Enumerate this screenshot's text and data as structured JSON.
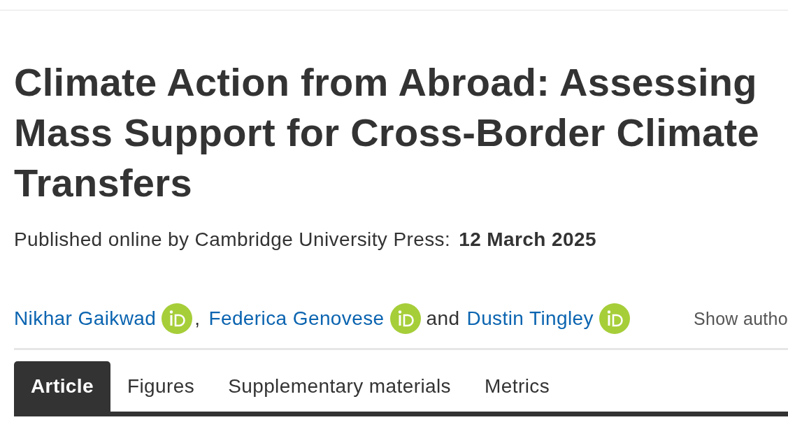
{
  "article": {
    "title": "Climate Action from Abroad: Assessing Mass Support for Cross-Border Climate Transfers",
    "published": {
      "label": "Published online by Cambridge University Press:",
      "date": "12 March 2025"
    },
    "authors": [
      {
        "name": "Nikhar Gaikwad",
        "orcid": true,
        "separator": ","
      },
      {
        "name": "Federica Genovese",
        "orcid": true,
        "separator": "and"
      },
      {
        "name": "Dustin Tingley",
        "orcid": true
      }
    ],
    "show_authors": "Show autho",
    "tabs": [
      {
        "label": "Article",
        "selected": true
      },
      {
        "label": "Figures",
        "selected": false
      },
      {
        "label": "Supplementary materials",
        "selected": false
      },
      {
        "label": "Metrics",
        "selected": false
      }
    ]
  }
}
